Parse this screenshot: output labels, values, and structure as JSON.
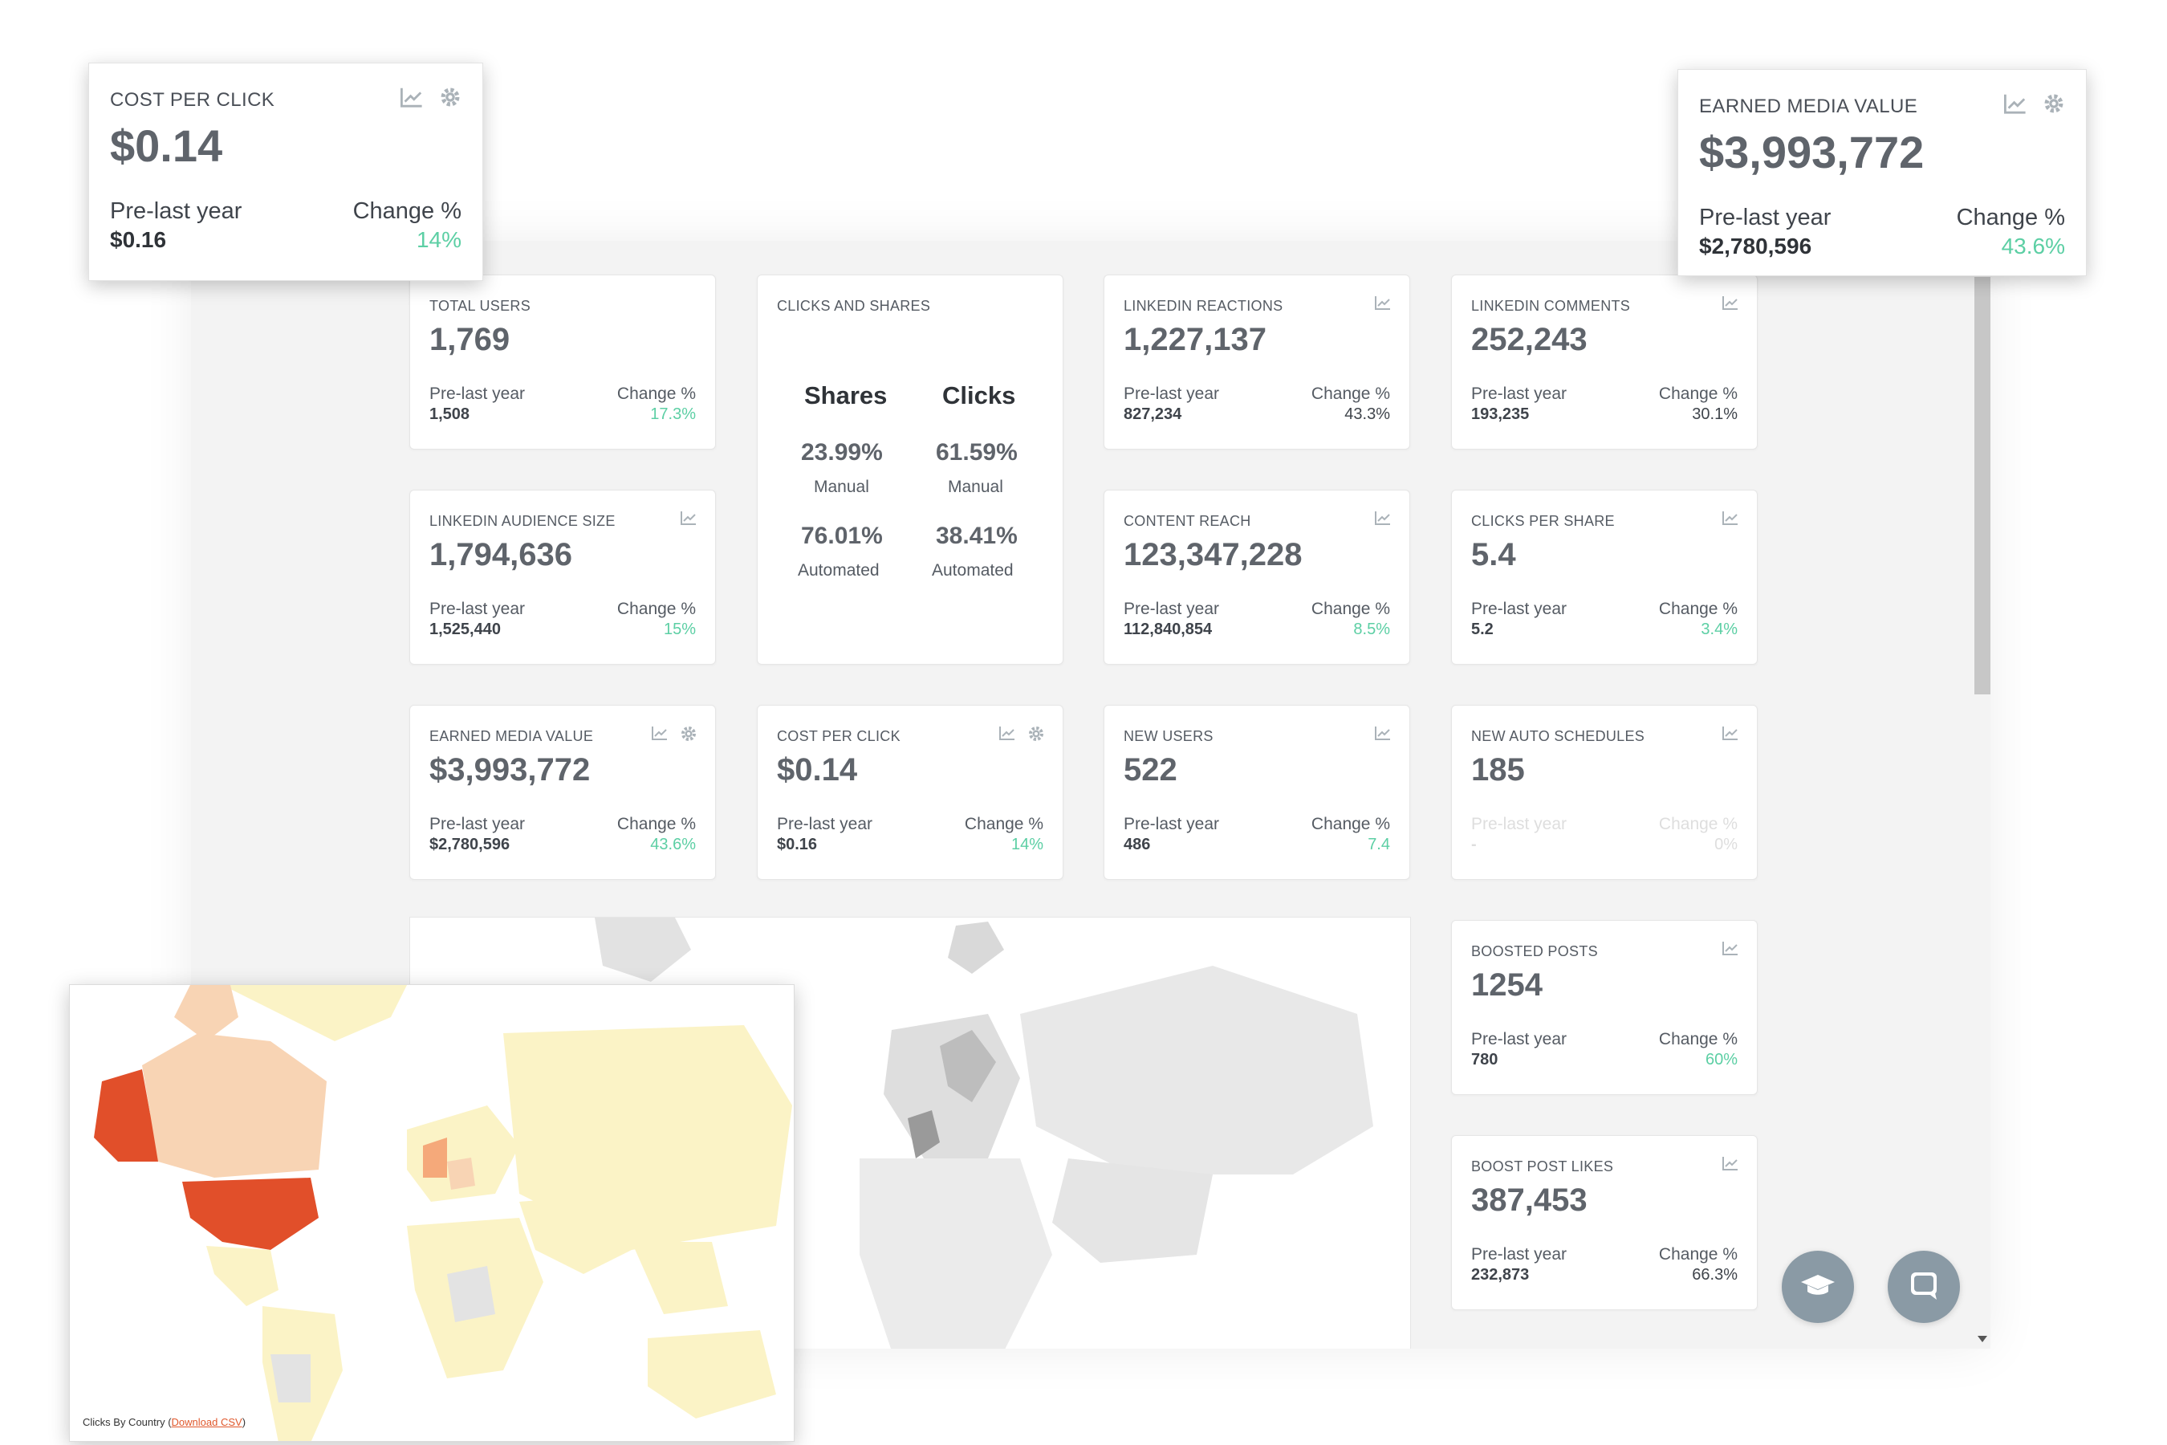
{
  "popouts": {
    "cost_per_click": {
      "title": "COST PER CLICK",
      "value": "$0.14",
      "prev_label": "Pre-last year",
      "prev_value": "$0.16",
      "change_label": "Change %",
      "change_value": "14%"
    },
    "earned_media": {
      "title": "EARNED MEDIA VALUE",
      "value": "$3,993,772",
      "prev_label": "Pre-last year",
      "prev_value": "$2,780,596",
      "change_label": "Change %",
      "change_value": "43.6%"
    }
  },
  "cards": {
    "total_users": {
      "title": "TOTAL USERS",
      "value": "1,769",
      "prev_label": "Pre-last year",
      "prev_value": "1,508",
      "change_label": "Change %",
      "change_value": "17.3%"
    },
    "linkedin_reactions": {
      "title": "LINKEDIN REACTIONS",
      "value": "1,227,137",
      "prev_label": "Pre-last year",
      "prev_value": "827,234",
      "change_label": "Change %",
      "change_value": "43.3%"
    },
    "linkedin_comments": {
      "title": "LINKEDIN COMMENTS",
      "value": "252,243",
      "prev_label": "Pre-last year",
      "prev_value": "193,235",
      "change_label": "Change %",
      "change_value": "30.1%"
    },
    "audience_size": {
      "title": "LINKEDIN AUDIENCE SIZE",
      "value": "1,794,636",
      "prev_label": "Pre-last year",
      "prev_value": "1,525,440",
      "change_label": "Change %",
      "change_value": "15%"
    },
    "content_reach": {
      "title": "CONTENT REACH",
      "value": "123,347,228",
      "prev_label": "Pre-last year",
      "prev_value": "112,840,854",
      "change_label": "Change %",
      "change_value": "8.5%"
    },
    "clicks_per_share": {
      "title": "CLICKS PER SHARE",
      "value": "5.4",
      "prev_label": "Pre-last year",
      "prev_value": "5.2",
      "change_label": "Change %",
      "change_value": "3.4%"
    },
    "earned_media": {
      "title": "EARNED MEDIA VALUE",
      "value": "$3,993,772",
      "prev_label": "Pre-last year",
      "prev_value": "$2,780,596",
      "change_label": "Change %",
      "change_value": "43.6%"
    },
    "cost_per_click": {
      "title": "COST PER CLICK",
      "value": "$0.14",
      "prev_label": "Pre-last year",
      "prev_value": "$0.16",
      "change_label": "Change %",
      "change_value": "14%"
    },
    "new_users": {
      "title": "NEW USERS",
      "value": "522",
      "prev_label": "Pre-last year",
      "prev_value": "486",
      "change_label": "Change %",
      "change_value": "7.4"
    },
    "auto_schedules": {
      "title": "NEW AUTO SCHEDULES",
      "value": "185",
      "prev_label": "Pre-last year",
      "prev_value": "-",
      "change_label": "Change %",
      "change_value": "0%"
    },
    "boosted_posts": {
      "title": "BOOSTED POSTS",
      "value": "1254",
      "prev_label": "Pre-last year",
      "prev_value": "780",
      "change_label": "Change %",
      "change_value": "60%"
    },
    "boost_post_likes": {
      "title": "BOOST POST LIKES",
      "value": "387,453",
      "prev_label": "Pre-last year",
      "prev_value": "232,873",
      "change_label": "Change %",
      "change_value": "66.3%"
    }
  },
  "clicks_shares": {
    "title": "CLICKS AND SHARES",
    "shares_label": "Shares",
    "clicks_label": "Clicks",
    "shares_manual": "23.99%",
    "clicks_manual": "61.59%",
    "manual_label": "Manual",
    "shares_auto": "76.01%",
    "clicks_auto": "38.41%",
    "auto_label": "Automated"
  },
  "map": {
    "caption_prefix": "Clicks By Country (",
    "download_link": "Download CSV",
    "caption_suffix": ")"
  },
  "icons": [
    "chart-icon",
    "gear-icon",
    "graduation-cap-icon",
    "chat-icon"
  ],
  "colors": {
    "accent_green": "#5ccfa4",
    "map_high": "#e14f2a",
    "map_mid": "#f8d4b4",
    "map_low": "#fbf3c6"
  }
}
